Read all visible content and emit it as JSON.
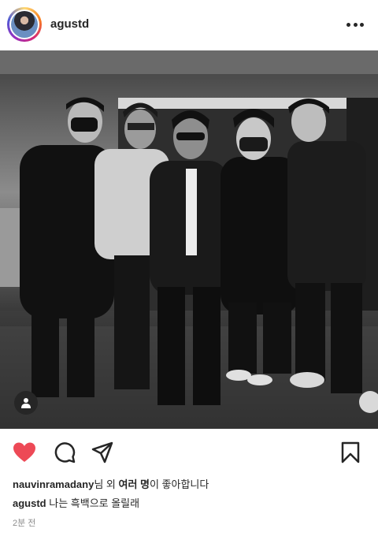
{
  "header": {
    "username": "agustd",
    "avatar_icon": "profile-avatar",
    "more_icon": "more-horizontal-icon"
  },
  "post": {
    "image_description_icon": "black-and-white-group-photo",
    "user_tag_icon": "user-tag-icon"
  },
  "actions": {
    "like_icon": "heart-filled-icon",
    "comment_icon": "comment-icon",
    "share_icon": "send-icon",
    "save_icon": "bookmark-icon",
    "like_color": "#ed4956"
  },
  "likes": {
    "user": "nauvinramadany",
    "text_middle": "님 외 ",
    "others": "여러 명",
    "text_end": "이 좋아합니다"
  },
  "caption": {
    "user": "agustd",
    "text": " 나는 흑백으로 올릴래"
  },
  "timestamp": "2분 전"
}
